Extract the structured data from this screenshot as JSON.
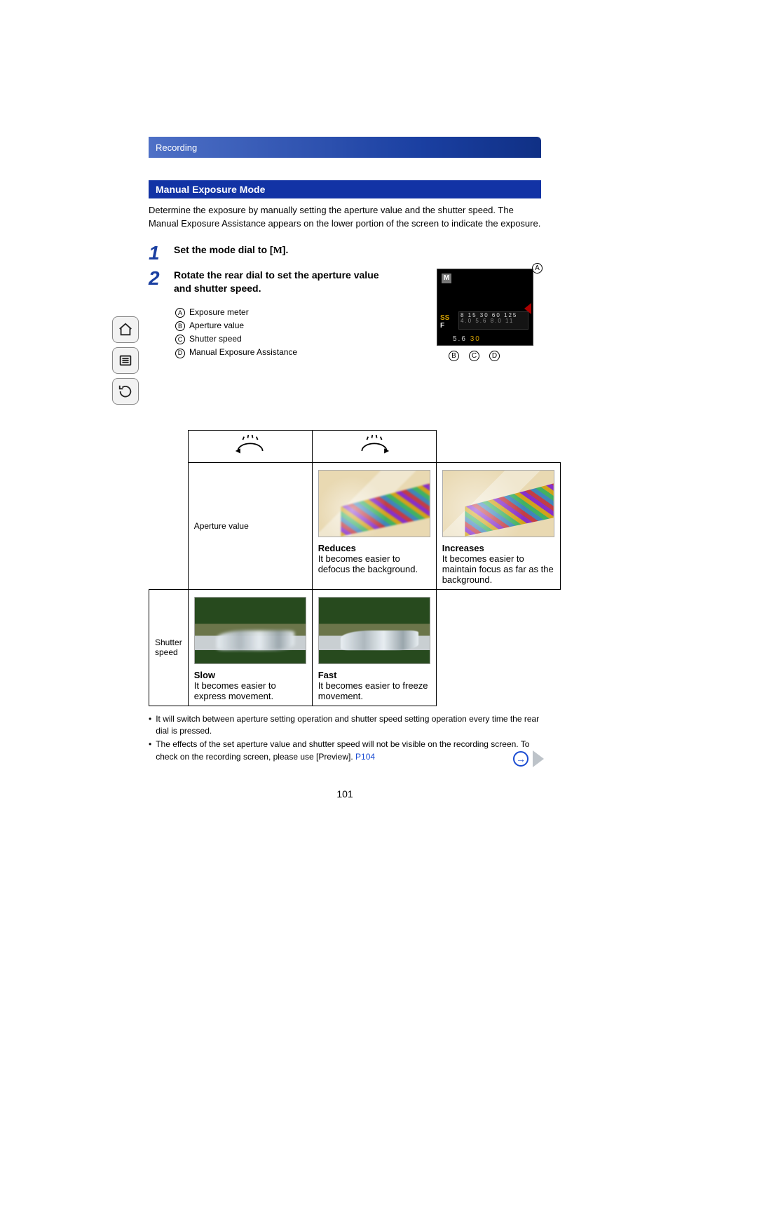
{
  "breadcrumb": "Recording",
  "section_title": "Manual Exposure Mode",
  "intro": "Determine the exposure by manually setting the aperture value and the shutter speed. The Manual Exposure Assistance appears on the lower portion of the screen to indicate the exposure.",
  "steps": {
    "s1": {
      "num": "1",
      "text_pre": "Set the mode dial to [",
      "mode_letter": "M",
      "text_post": "]."
    },
    "s2": {
      "num": "2",
      "text": "Rotate the rear dial to set the aperture value and shutter speed."
    }
  },
  "legend": {
    "A": "Exposure meter",
    "B": "Aperture value",
    "C": "Shutter speed",
    "D": "Manual Exposure Assistance"
  },
  "figure": {
    "callouts": {
      "A": "A",
      "B": "B",
      "C": "C",
      "D": "D"
    },
    "lcd": {
      "mode": "M",
      "ss_label": "SS",
      "f_label": "F",
      "scale_top": "8   15   30   60  125",
      "scale_bot": "4.0   5.6   8.0   11",
      "foot_b": "5.6",
      "foot_c": "30"
    }
  },
  "table": {
    "row1_label": "Aperture value",
    "row2_label": "Shutter speed",
    "c1": {
      "title": "Reduces",
      "desc": "It becomes easier to defocus the background."
    },
    "c2": {
      "title": "Increases",
      "desc": "It becomes easier to maintain focus as far as the background."
    },
    "c3": {
      "title": "Slow",
      "desc": "It becomes easier to express movement."
    },
    "c4": {
      "title": "Fast",
      "desc": "It becomes easier to freeze movement."
    }
  },
  "notes": {
    "n1": "It will switch between aperture setting operation and shutter speed setting operation every time the rear dial is pressed.",
    "n2": "The effects of the set aperture value and shutter speed will not be visible on the recording screen. To check on the recording screen, please use [Preview]. ",
    "link": "P104"
  },
  "page_number": "101"
}
